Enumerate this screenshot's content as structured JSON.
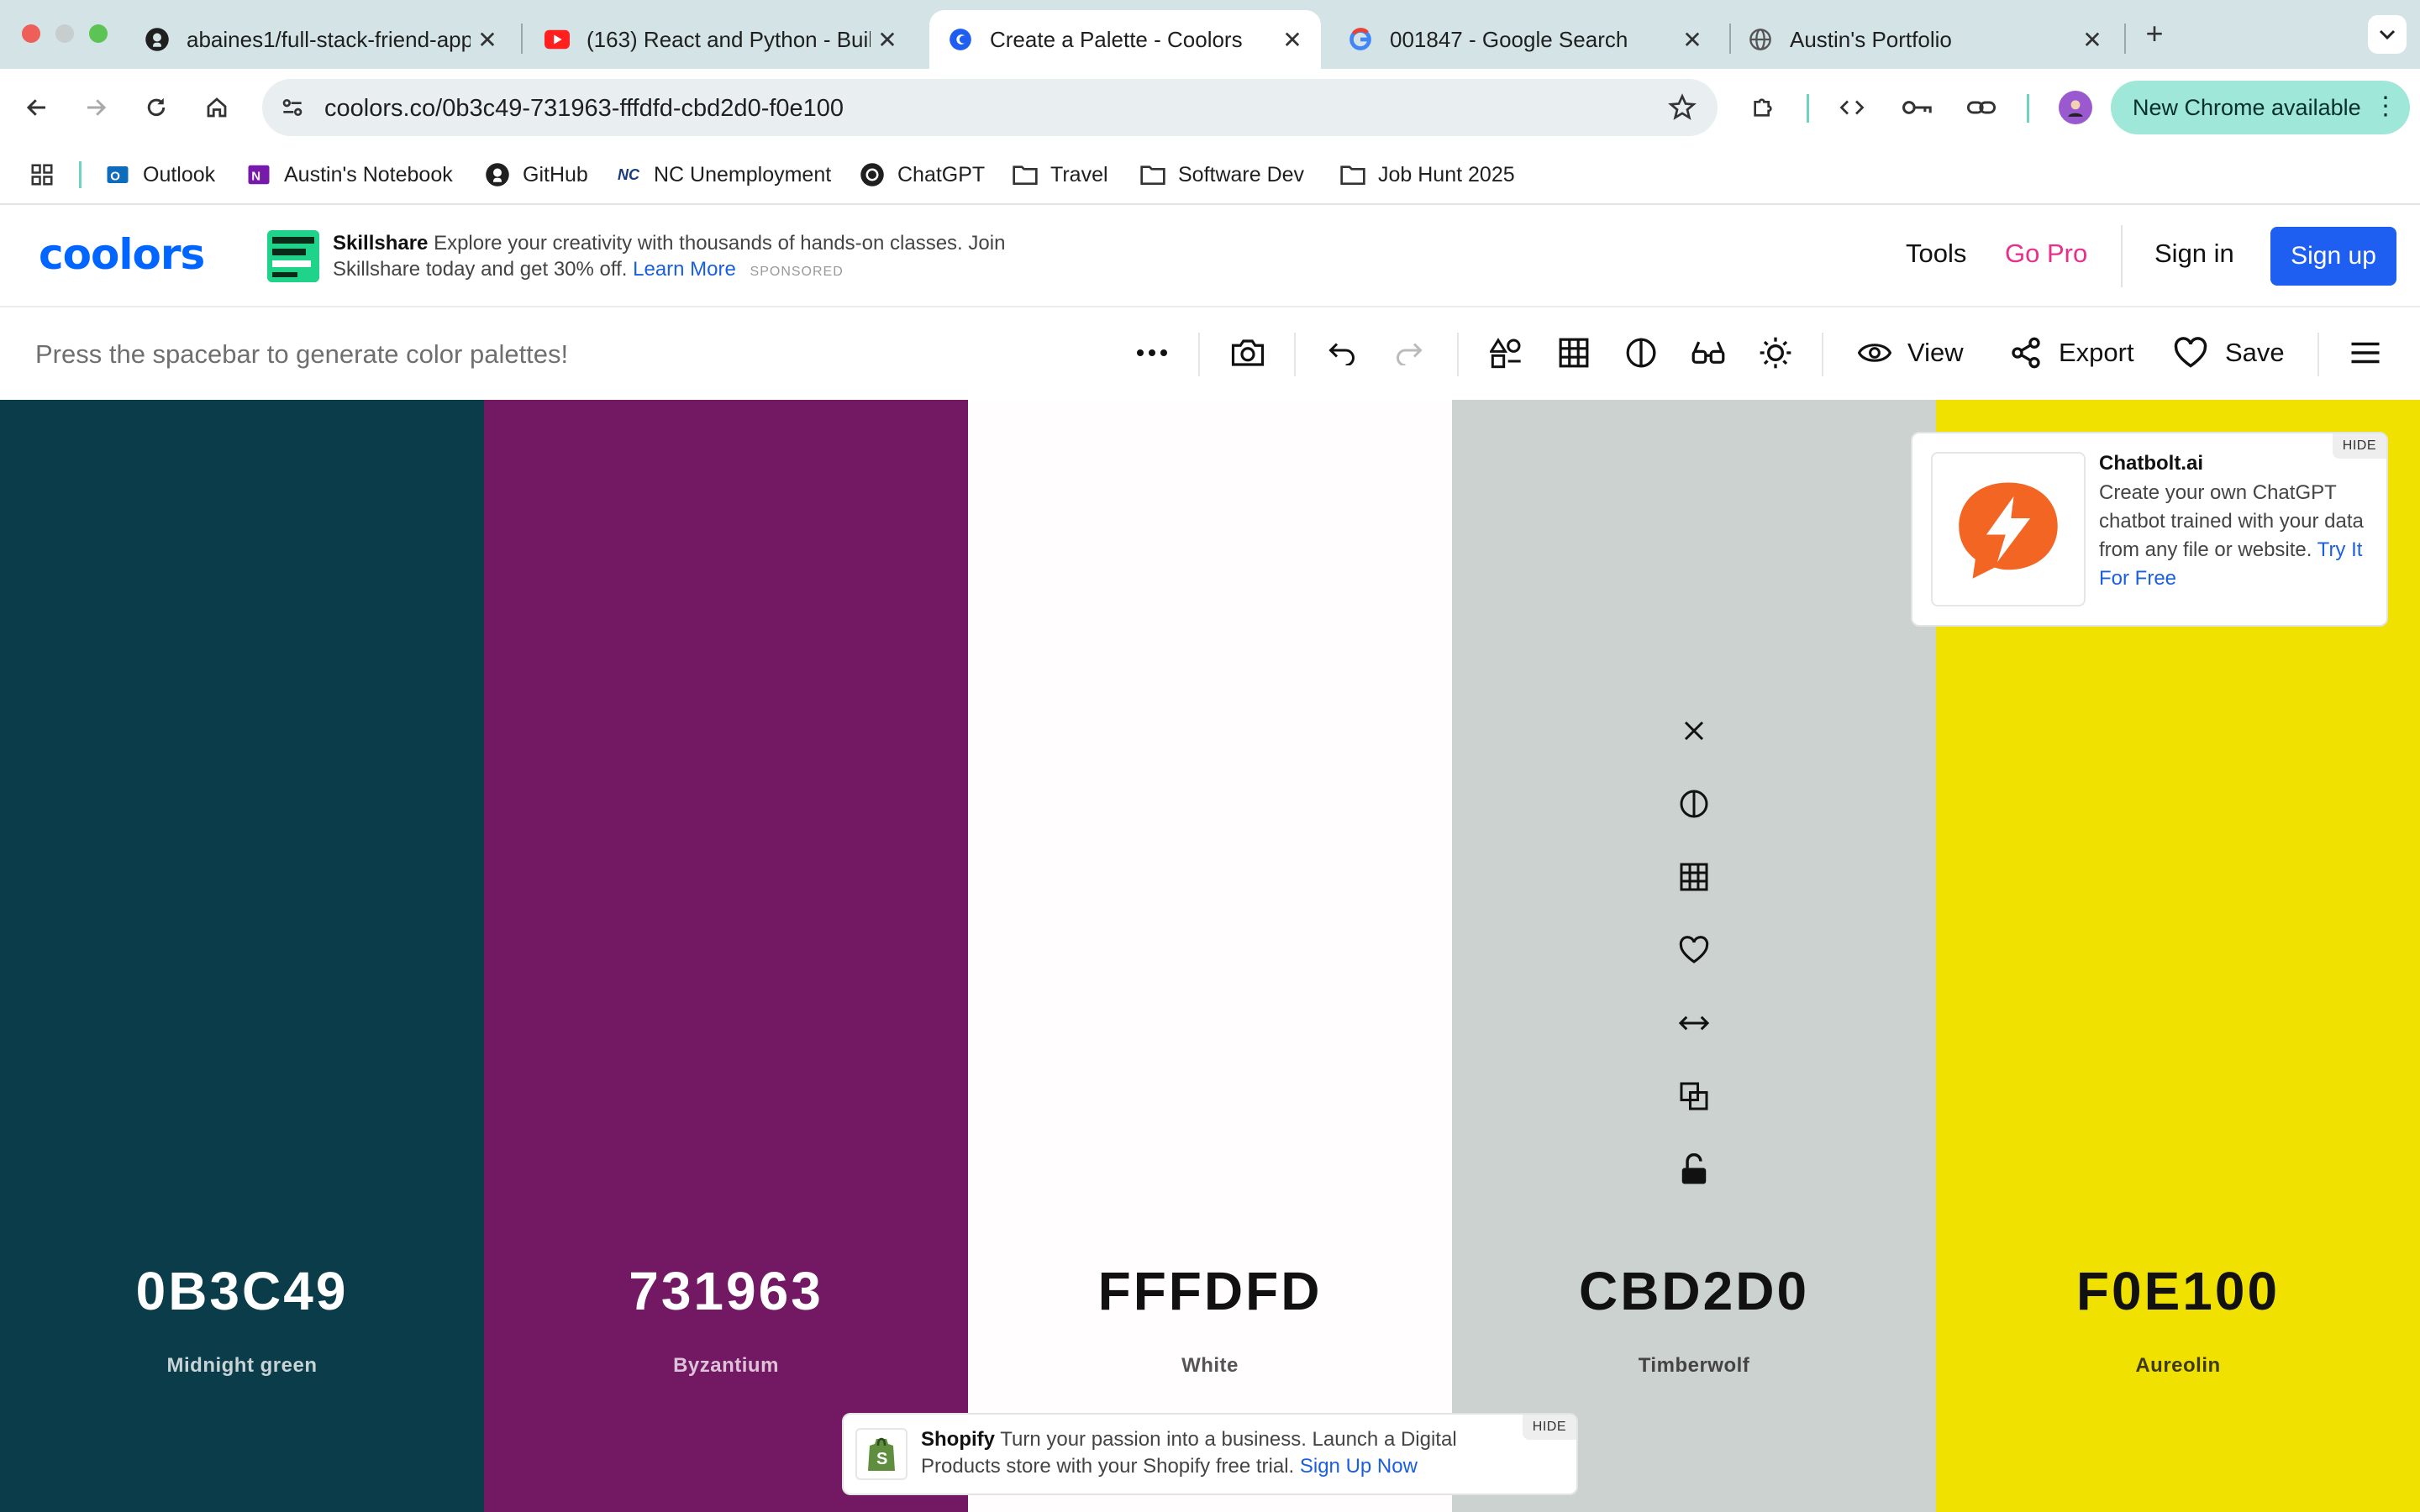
{
  "browser": {
    "tabs": [
      {
        "title": "abaines1/full-stack-friend-app",
        "icon": "github-icon"
      },
      {
        "title": "(163) React and Python - Buil",
        "icon": "youtube-icon"
      },
      {
        "title": "Create a Palette - Coolors",
        "icon": "coolors-icon",
        "active": true
      },
      {
        "title": "001847 - Google Search",
        "icon": "google-icon"
      },
      {
        "title": "Austin's Portfolio",
        "icon": "globe-icon"
      }
    ],
    "url": "coolors.co/0b3c49-731963-fffdfd-cbd2d0-f0e100",
    "update_pill": "New Chrome available",
    "bookmarks": [
      {
        "label": "Outlook",
        "icon": "outlook-icon"
      },
      {
        "label": "Austin's Notebook",
        "icon": "onenote-icon"
      },
      {
        "label": "GitHub",
        "icon": "github-icon"
      },
      {
        "label": "NC Unemployment",
        "icon": "nc-icon"
      },
      {
        "label": "ChatGPT",
        "icon": "chatgpt-icon"
      },
      {
        "label": "Travel",
        "icon": "folder-icon"
      },
      {
        "label": "Software Dev",
        "icon": "folder-icon"
      },
      {
        "label": "Job Hunt 2025",
        "icon": "folder-icon"
      }
    ]
  },
  "header": {
    "logo": "coolors",
    "ad": {
      "brand": "Skillshare",
      "text": "Explore your creativity with thousands of hands-on classes. Join Skillshare today and get 30% off.",
      "link": "Learn More",
      "sponsored": "SPONSORED"
    },
    "nav": {
      "tools": "Tools",
      "go_pro": "Go Pro",
      "sign_in": "Sign in",
      "sign_up": "Sign up"
    }
  },
  "toolbar": {
    "hint": "Press the spacebar to generate color palettes!",
    "view": "View",
    "export": "Export",
    "save": "Save"
  },
  "palette": [
    {
      "hex": "0B3C49",
      "name": "Midnight green",
      "color": "#0b3c49",
      "text_color": "#ffffff",
      "sub_color": "#c8d3d6"
    },
    {
      "hex": "731963",
      "name": "Byzantium",
      "color": "#731963",
      "text_color": "#ffffff",
      "sub_color": "#dcc3d8"
    },
    {
      "hex": "FFFDFD",
      "name": "White",
      "color": "#fffdfd",
      "text_color": "#111111",
      "sub_color": "#555555"
    },
    {
      "hex": "CBD2D0",
      "name": "Timberwolf",
      "color": "#cbd2d0",
      "text_color": "#111111",
      "sub_color": "#444444"
    },
    {
      "hex": "F0E100",
      "name": "Aureolin",
      "color": "#f0e100",
      "text_color": "#111111",
      "sub_color": "#3d3a10"
    }
  ],
  "hover_column_tools": [
    "close-icon",
    "contrast-icon",
    "shades-grid-icon",
    "heart-icon",
    "drag-arrows-icon",
    "copy-icon",
    "unlock-icon"
  ],
  "side_ad": {
    "brand": "Chatbolt.ai",
    "text": "Create your own ChatGPT chatbot trained with your data from any file or website.",
    "link": "Try It For Free",
    "hide": "HIDE"
  },
  "bottom_ad": {
    "brand": "Shopify",
    "text": "Turn your passion into a business. Launch a Digital Products store with your Shopify free trial.",
    "link": "Sign Up Now",
    "hide": "HIDE"
  }
}
